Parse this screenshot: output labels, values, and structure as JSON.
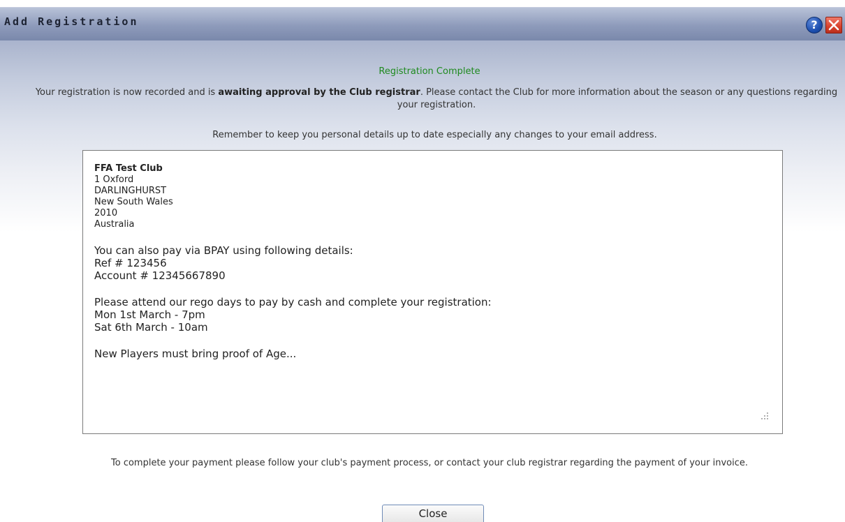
{
  "window": {
    "title": "Add Registration",
    "help_icon": "?",
    "close_icon": "close-icon"
  },
  "status": {
    "heading": "Registration Complete",
    "intro_before": "Your registration is now recorded and is ",
    "intro_bold": "awaiting approval by the Club registrar",
    "intro_after": ". Please contact the Club for more information about the season or any questions regarding your registration.",
    "reminder": "Remember to keep you personal details up to date especially any changes to your email address."
  },
  "club": {
    "name": "FFA Test Club",
    "address_lines": [
      "1 Oxford",
      "DARLINGHURST",
      "New South Wales",
      "2010",
      "Australia"
    ]
  },
  "bpay": {
    "heading": "You can also pay via BPAY using following details:",
    "ref": "Ref # 123456",
    "account": "Account # 12345667890"
  },
  "rego_days": {
    "heading": "Please attend our rego days to pay by cash and complete your registration:",
    "days": [
      "Mon 1st March - 7pm",
      "Sat 6th March - 10am"
    ]
  },
  "note": "New Players must bring proof of Age...",
  "payment_note": "To complete your payment please follow your club's payment process, or contact your club registrar regarding the payment of your invoice.",
  "close_button": "Close",
  "colors": {
    "status_green": "#1f8a1f",
    "titlebar": "#8e9bbb",
    "close_red": "#d8412c",
    "help_blue": "#1d4fb0"
  }
}
